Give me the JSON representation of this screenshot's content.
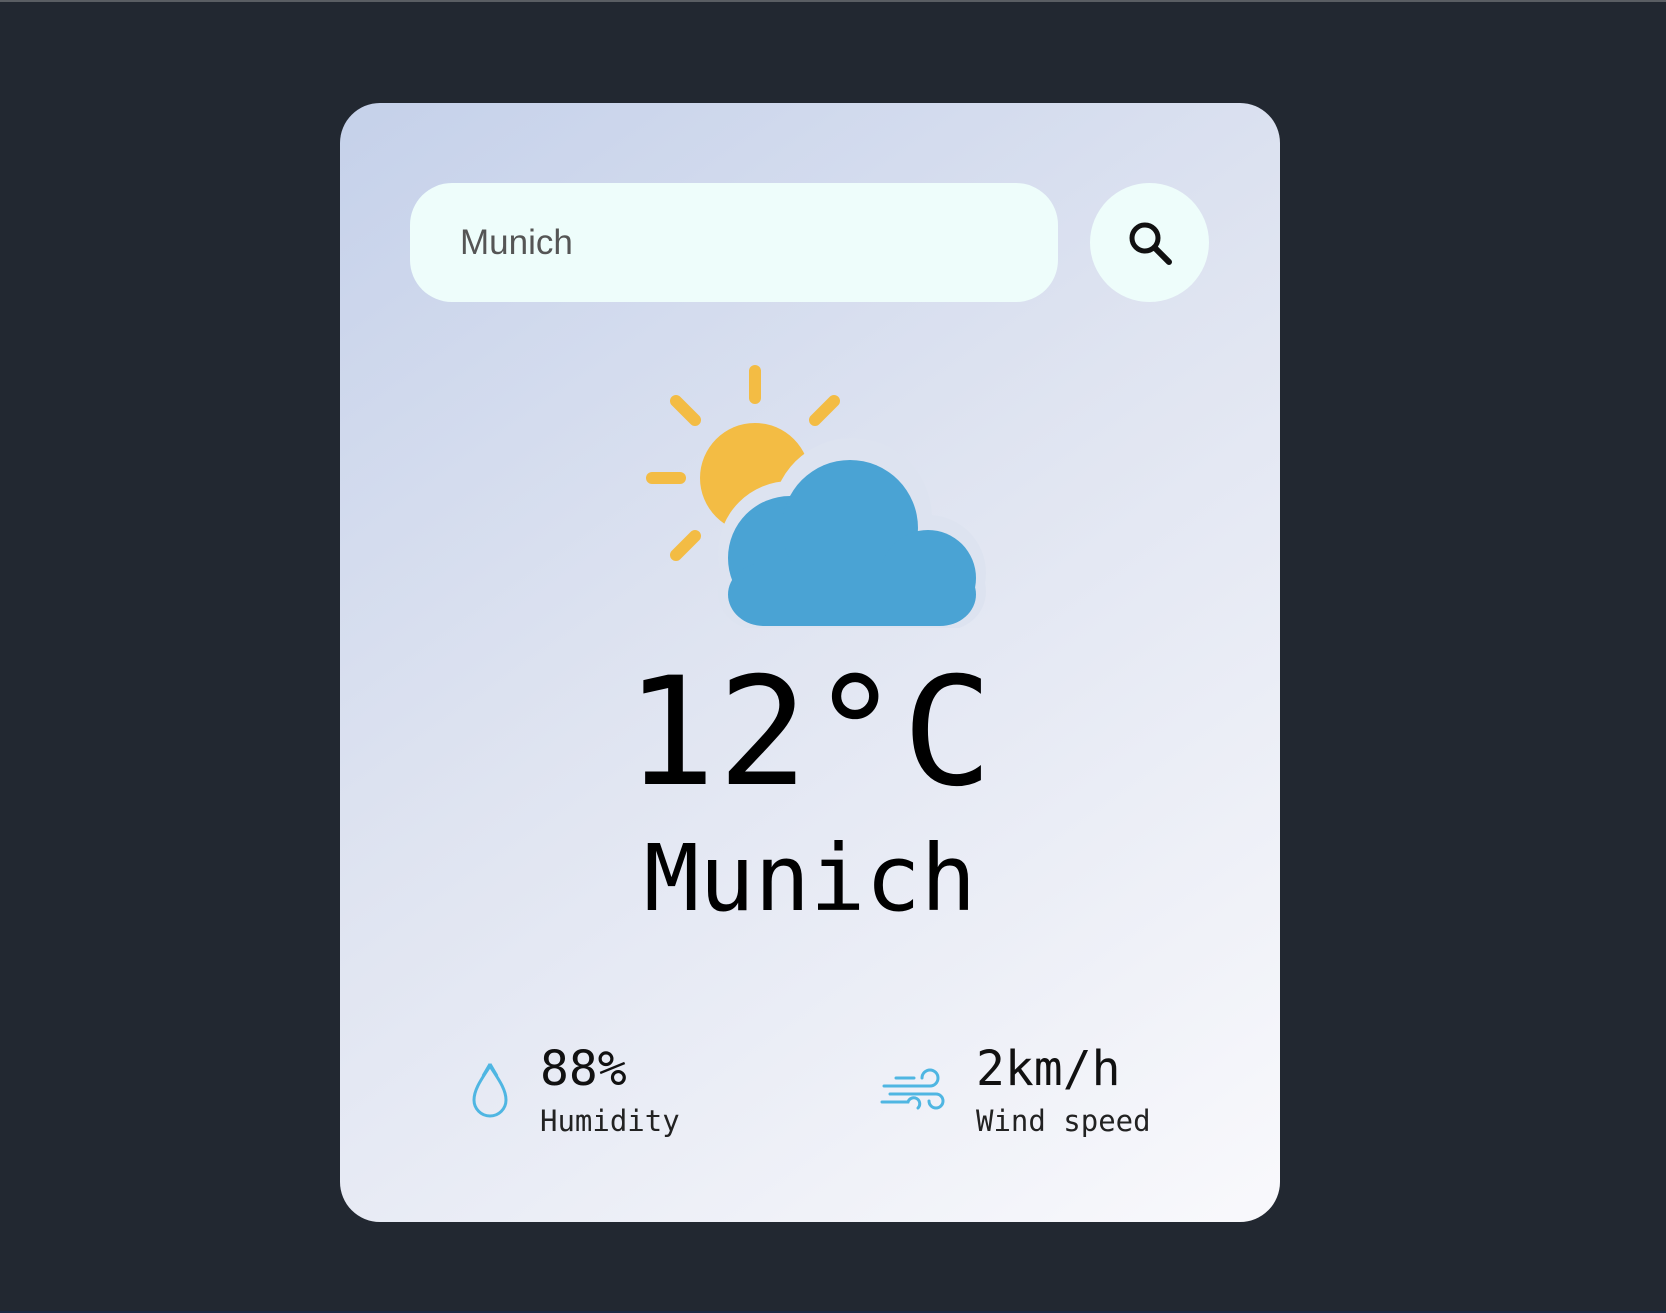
{
  "search": {
    "value": "Munich",
    "icon": "search-icon"
  },
  "weather": {
    "icon": "partly-cloudy-icon",
    "temperature": "12°C",
    "city": "Munich"
  },
  "details": {
    "humidity": {
      "icon": "humidity-drop-icon",
      "value": "88%",
      "label": "Humidity"
    },
    "wind": {
      "icon": "wind-icon",
      "value": "2km/h",
      "label": "Wind speed"
    }
  },
  "colors": {
    "background": "#222831",
    "card_gradient_start": "#c5d1ea",
    "card_gradient_end": "#f9f9fc",
    "input_background": "#eefdfb",
    "sun": "#f3bc44",
    "cloud": "#4aa3d4",
    "detail_icon": "#4fb6e2"
  }
}
